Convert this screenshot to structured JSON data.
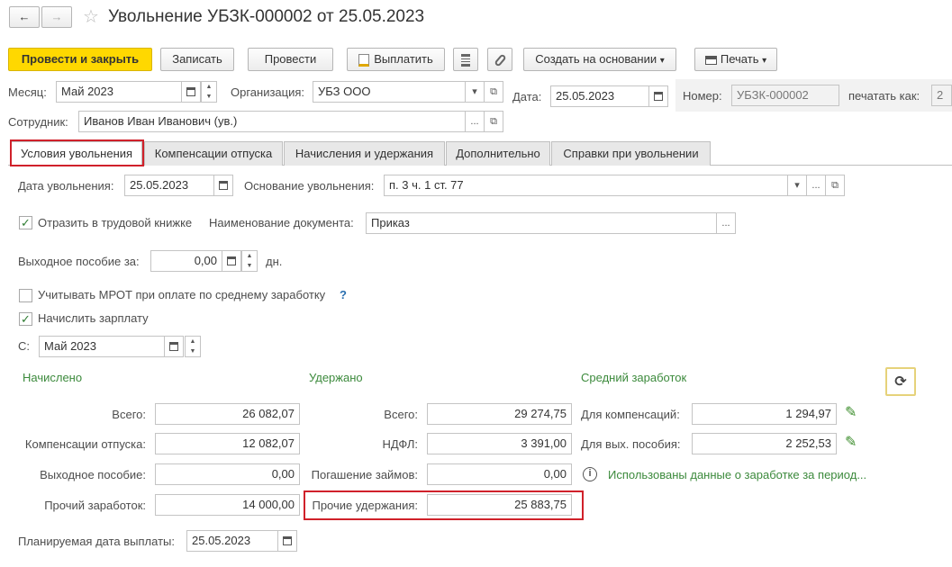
{
  "window": {
    "title": "Увольнение УБЗК-000002 от 25.05.2023",
    "back_icon": "←",
    "forward_icon": "→",
    "star_icon": "☆"
  },
  "toolbar": {
    "post_close": "Провести и закрыть",
    "save": "Записать",
    "post": "Провести",
    "pay": "Выплатить",
    "create_based": "Создать на основании",
    "print": "Печать",
    "dropdown_arrow": "▾"
  },
  "header": {
    "month_label": "Месяц:",
    "month_value": "Май 2023",
    "org_label": "Организация:",
    "org_value": "УБЗ ООО",
    "date_label": "Дата:",
    "date_value": "25.05.2023",
    "number_label": "Номер:",
    "number_value": "УБЗК-000002",
    "print_as_label": "печатать как:",
    "print_as_value": "2",
    "employee_label": "Сотрудник:",
    "employee_value": "Иванов Иван Иванович (ув.)",
    "ellipsis": "...",
    "copy_icon": "⧉"
  },
  "tabs": [
    {
      "label": "Условия увольнения"
    },
    {
      "label": "Компенсации отпуска"
    },
    {
      "label": "Начисления и удержания"
    },
    {
      "label": "Дополнительно"
    },
    {
      "label": "Справки при увольнении"
    }
  ],
  "conditions": {
    "dismissal_date_label": "Дата увольнения:",
    "dismissal_date_value": "25.05.2023",
    "reason_label": "Основание увольнения:",
    "reason_value": "п. 3 ч. 1 ст. 77",
    "workbook_checkbox": "Отразить в трудовой книжке",
    "doc_name_label": "Наименование документа:",
    "doc_name_value": "Приказ",
    "severance_label": "Выходное пособие за:",
    "severance_value": "0,00",
    "severance_unit": "дн.",
    "mrot_checkbox": "Учитывать МРОТ при оплате по среднему заработку",
    "help_mark": "?",
    "accrue_salary_checkbox": "Начислить зарплату",
    "from_label": "С:",
    "from_value": "Май 2023",
    "check_mark": "✓"
  },
  "accrued": {
    "header": "Начислено",
    "total_label": "Всего:",
    "total_value": "26 082,07",
    "vacation_label": "Компенсации отпуска:",
    "vacation_value": "12 082,07",
    "severance_label": "Выходное пособие:",
    "severance_value": "0,00",
    "other_label": "Прочий заработок:",
    "other_value": "14 000,00"
  },
  "withheld": {
    "header": "Удержано",
    "total_label": "Всего:",
    "total_value": "29 274,75",
    "ndfl_label": "НДФЛ:",
    "ndfl_value": "3 391,00",
    "loans_label": "Погашение займов:",
    "loans_value": "0,00",
    "other_label": "Прочие удержания:",
    "other_value": "25 883,75"
  },
  "average": {
    "header": "Средний заработок",
    "comp_label": "Для компенсаций:",
    "comp_value": "1 294,97",
    "sev_label": "Для вых. пособия:",
    "sev_value": "2 252,53",
    "info_text": "Использованы данные о заработке за период...",
    "info_icon": "i",
    "pencil_icon": "✎",
    "refresh_icon": "⟳"
  },
  "payment": {
    "planned_date_label": "Планируемая дата выплаты:",
    "planned_date_value": "25.05.2023"
  }
}
